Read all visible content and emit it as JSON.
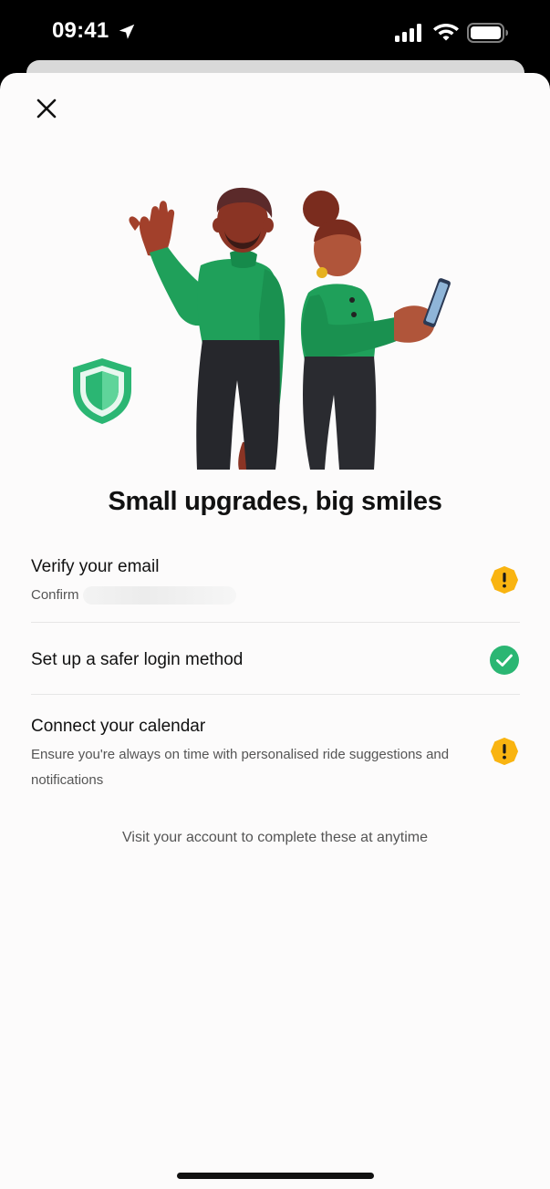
{
  "status_bar": {
    "time": "09:41",
    "icons": [
      "location-arrow-icon",
      "cellular-signal-icon",
      "wifi-icon",
      "battery-icon"
    ]
  },
  "header": {
    "close_icon": "close-icon"
  },
  "hero": {
    "illustration": "two-people-illustration",
    "badge_icon": "shield-icon"
  },
  "title": "Small upgrades, big smiles",
  "tasks": [
    {
      "title": "Verify your email",
      "subtitle": "Confirm",
      "status": "warning",
      "status_icon": "warning-icon"
    },
    {
      "title": "Set up a safer login method",
      "status": "complete",
      "status_icon": "check-circle-icon"
    },
    {
      "title": "Connect your calendar",
      "subtitle": "Ensure you're always on time with personalised ride suggestions and notifications",
      "status": "warning",
      "status_icon": "warning-icon"
    }
  ],
  "footer_note": "Visit your account to complete these at anytime",
  "colors": {
    "brand_green": "#2bb673",
    "warning_yellow": "#f9b411",
    "text_primary": "#111111",
    "text_secondary": "#555555"
  }
}
